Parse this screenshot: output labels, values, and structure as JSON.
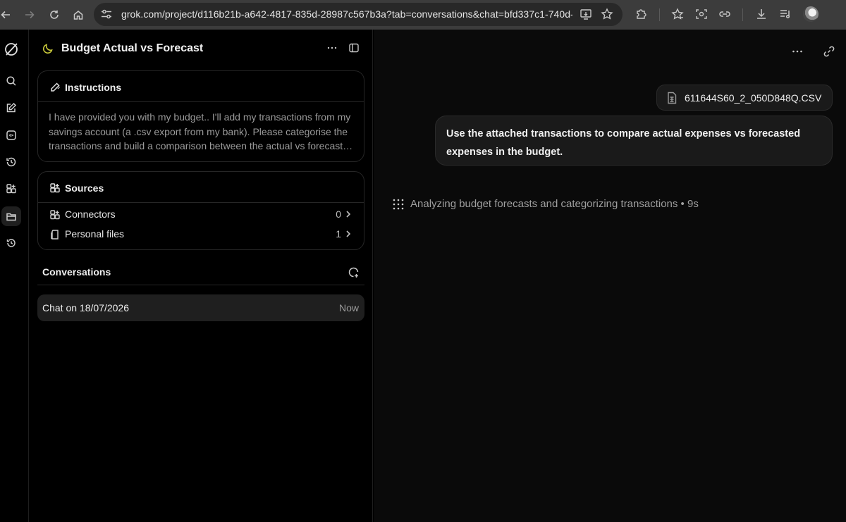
{
  "browser": {
    "url": "grok.com/project/d116b21b-a642-4817-835d-28987c567b3a?tab=conversations&chat=bfd337c1-740d-4..."
  },
  "project": {
    "title": "Budget Actual vs Forecast",
    "instructions": {
      "label": "Instructions",
      "text": "I have provided you with my budget.. I'll add my transactions from my savings account (a .csv export from my bank). Please categorise the transactions and build a comparison between the actual vs forecast…"
    },
    "sources": {
      "label": "Sources",
      "items": [
        {
          "label": "Connectors",
          "count": "0"
        },
        {
          "label": "Personal files",
          "count": "1"
        }
      ]
    },
    "conversations": {
      "label": "Conversations",
      "items": [
        {
          "label": "Chat on 18/07/2026",
          "time": "Now"
        }
      ]
    }
  },
  "chat": {
    "attachment": "611644S60_2_050D848Q.CSV",
    "message": "Use the attached transactions to compare actual expenses vs forecasted expenses in the budget.",
    "status": "Analyzing budget forecasts and categorizing transactions • 9s"
  },
  "colors": {
    "background": "#000000",
    "panel_border": "#262626",
    "bubble": "#1a1a1a",
    "accent_moon": "#c9c93a"
  }
}
